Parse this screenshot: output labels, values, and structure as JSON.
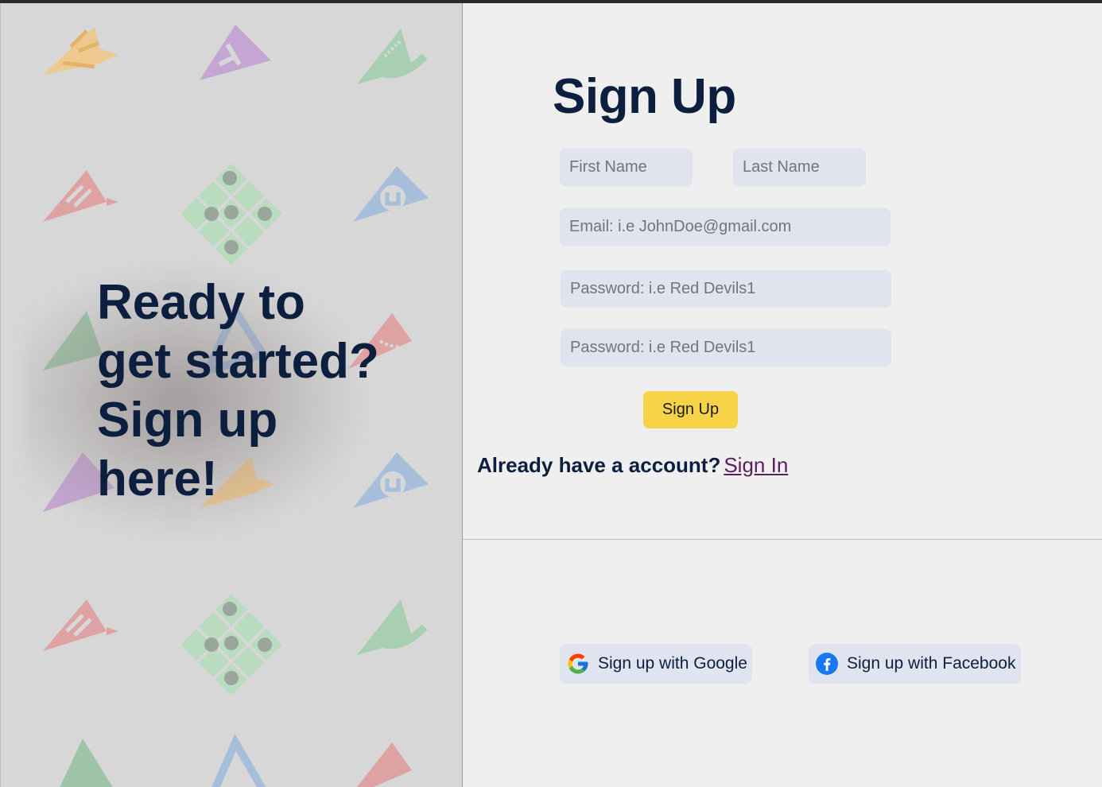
{
  "hero": {
    "line1": "Ready to",
    "line2": "get started?",
    "line3": "Sign up",
    "line4": "here!"
  },
  "form": {
    "title": "Sign Up",
    "first_name_placeholder": "First Name",
    "last_name_placeholder": "Last Name",
    "email_placeholder": "Email: i.e JohnDoe@gmail.com",
    "password_placeholder": "Password: i.e Red Devils1",
    "confirm_password_placeholder": "Password: i.e Red Devils1",
    "submit_label": "Sign Up"
  },
  "signin": {
    "prompt": "Already have a account?",
    "link_label": "Sign In"
  },
  "social": {
    "google_label": "Sign up with Google",
    "facebook_label": "Sign up with Facebook"
  },
  "colors": {
    "accent_yellow": "#f7d447",
    "navy_text": "#0d1f3f",
    "input_bg": "#dfe4ee",
    "link": "#5b1f5f"
  },
  "icons": {
    "google": "google-icon",
    "facebook": "facebook-icon"
  }
}
